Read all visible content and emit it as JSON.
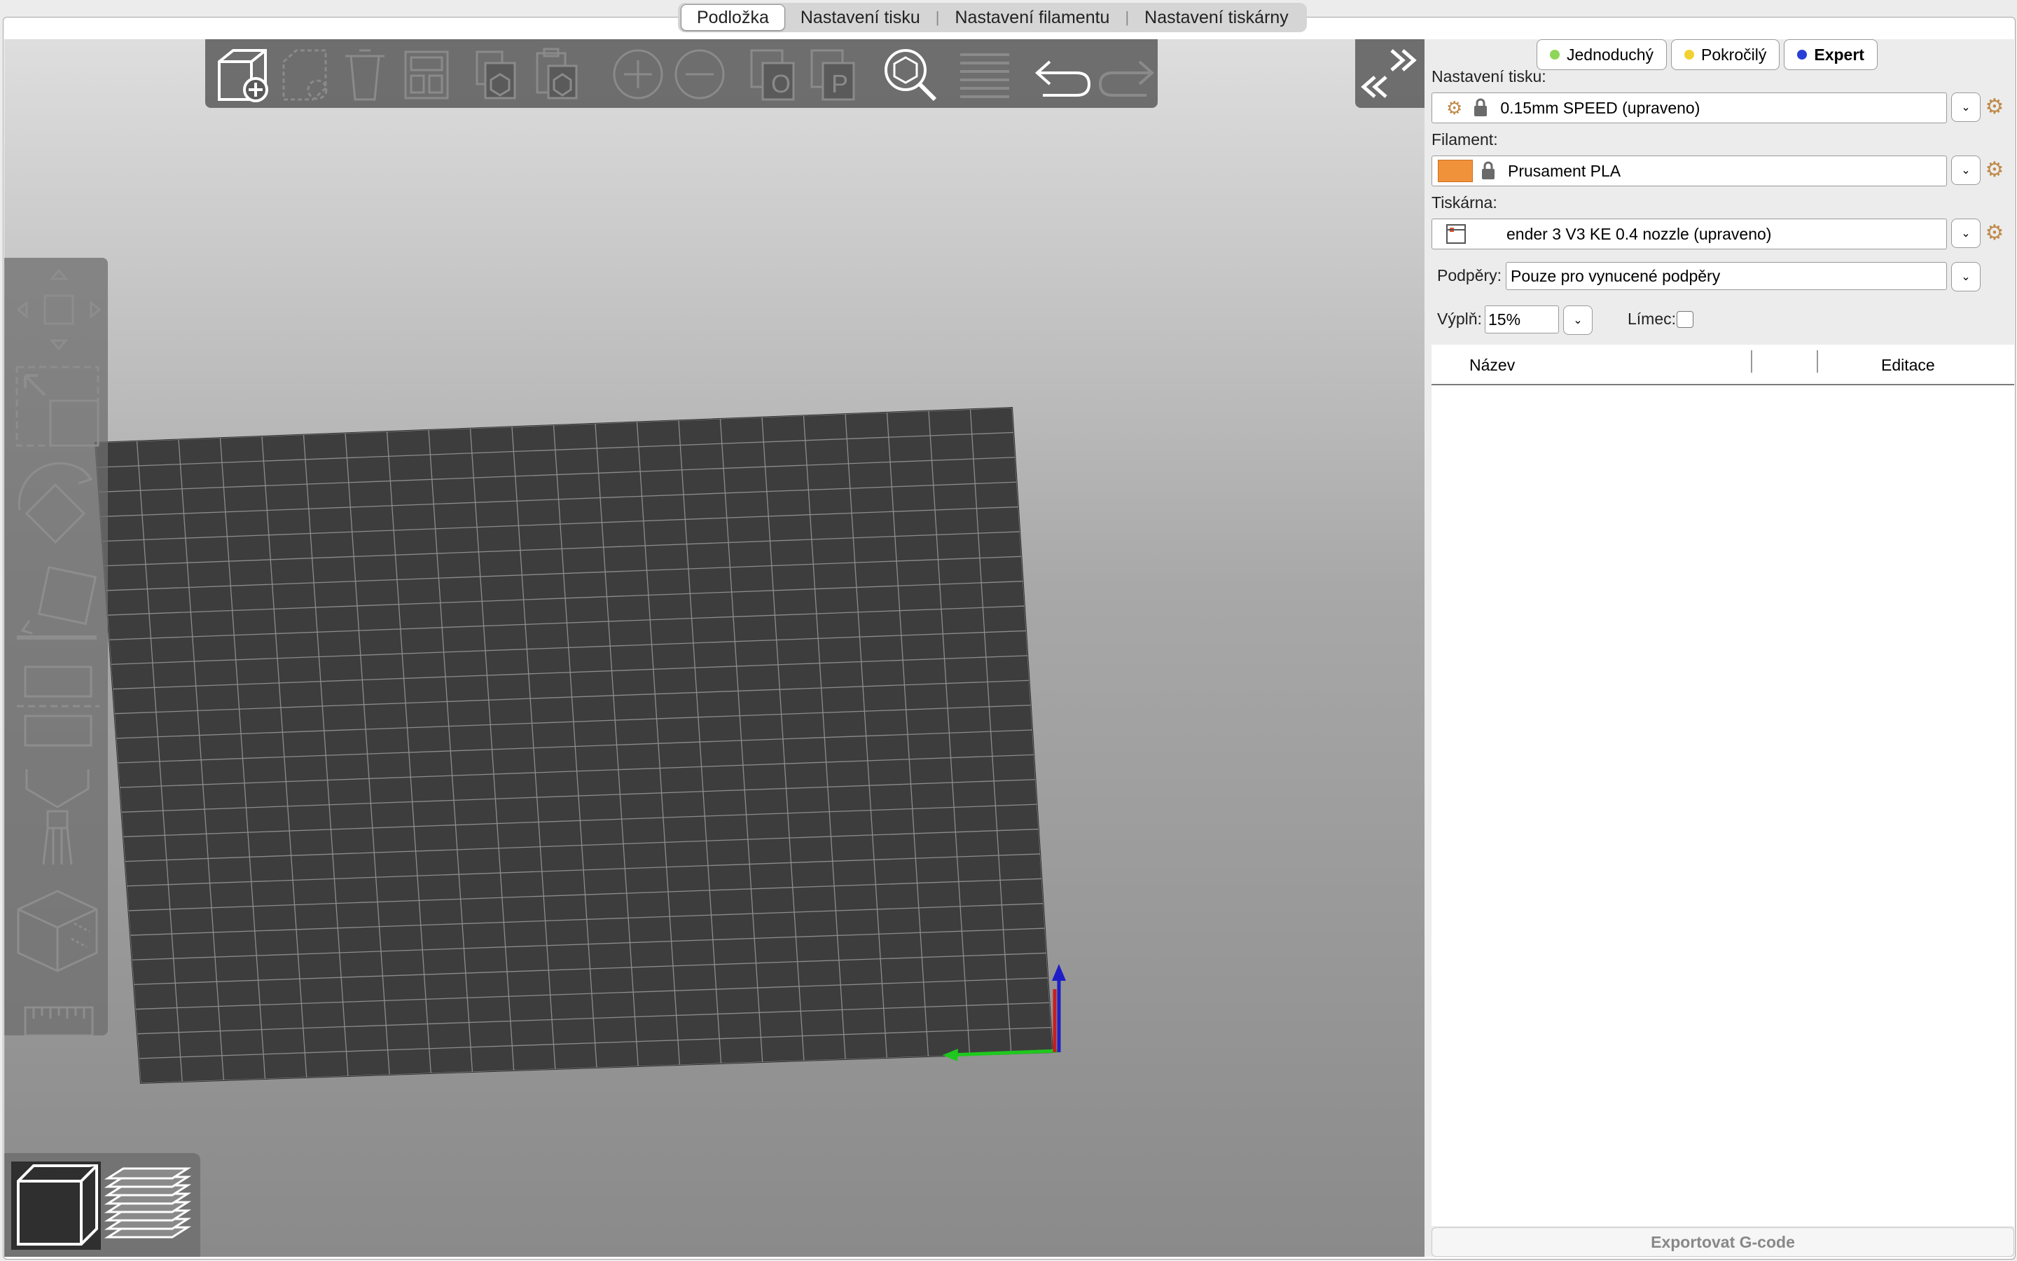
{
  "tabs": [
    "Podložka",
    "Nastavení tisku",
    "Nastavení filamentu",
    "Nastavení tiskárny"
  ],
  "modes": [
    {
      "label": "Jednoduchý",
      "color": "#8ed65a"
    },
    {
      "label": "Pokročilý",
      "color": "#f2d232"
    },
    {
      "label": "Expert",
      "color": "#2a3fd6"
    }
  ],
  "active_mode": "Expert",
  "print_settings": {
    "label": "Nastavení tisku:",
    "value": "0.15mm SPEED (upraveno)"
  },
  "filament": {
    "label": "Filament:",
    "value": "Prusament PLA",
    "color": "#f0923a"
  },
  "printer": {
    "label": "Tiskárna:",
    "value": "ender 3 V3 KE 0.4 nozzle (upraveno)"
  },
  "supports": {
    "label": "Podpěry:",
    "value": "Pouze pro vynucené podpěry"
  },
  "infill": {
    "label": "Výplň:",
    "value": "15%"
  },
  "brim": {
    "label": "Límec:",
    "checked": false
  },
  "object_list": {
    "col_name": "Název",
    "col_edit": "Editace"
  },
  "export_label": "Exportovat G-code",
  "colors": {
    "plate": "#3d3d3d",
    "grid": "#9a9a9a",
    "axis_x": "#1ec81e",
    "axis_y": "#c81e1e",
    "axis_z": "#1e1ec8"
  },
  "toolbar_icons": [
    "add-icon",
    "delete-icon",
    "delete-all-icon",
    "arrange-icon",
    "copy-icon",
    "paste-icon",
    "add-instance-icon",
    "remove-instance-icon",
    "split-objects-icon",
    "split-parts-icon",
    "search-icon",
    "layers-icon",
    "undo-icon",
    "redo-icon"
  ],
  "left_tools": [
    "move-icon",
    "scale-icon",
    "rotate-icon",
    "place-on-face-icon",
    "cut-icon",
    "paint-supports-icon",
    "seam-icon",
    "measure-icon"
  ],
  "view_modes": [
    "3d-view-icon",
    "preview-icon"
  ]
}
